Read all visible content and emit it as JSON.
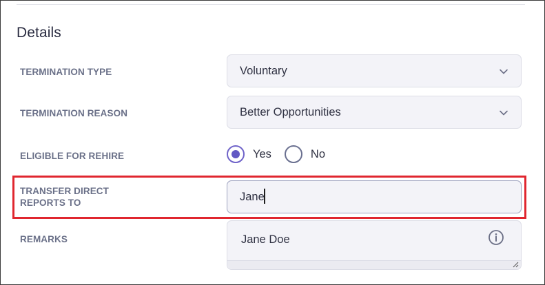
{
  "section": {
    "title": "Details"
  },
  "fields": {
    "termination_type": {
      "label": "TERMINATION TYPE",
      "value": "Voluntary",
      "icon": "chevron-down-icon"
    },
    "termination_reason": {
      "label": "TERMINATION REASON",
      "value": "Better Opportunities",
      "icon": "chevron-down-icon"
    },
    "eligible_for_rehire": {
      "label": "ELIGIBLE FOR REHIRE",
      "options": [
        {
          "label": "Yes",
          "selected": true
        },
        {
          "label": "No",
          "selected": false
        }
      ]
    },
    "transfer_direct_reports": {
      "label_line1": "TRANSFER DIRECT",
      "label_line2": "REPORTS TO",
      "value": "Jane"
    },
    "remarks": {
      "label": "REMARKS",
      "value": "Jane Doe",
      "icon": "info-icon"
    }
  },
  "colors": {
    "accent": "#6258c4",
    "highlight": "#e0262f",
    "label": "#6a7088",
    "field_bg": "#f3f3f8"
  }
}
